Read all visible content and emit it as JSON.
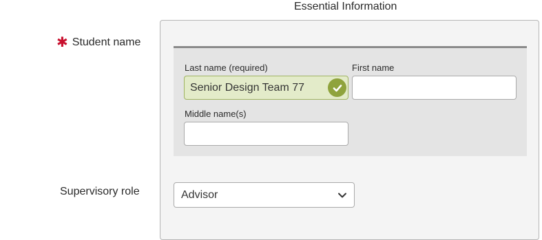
{
  "section": {
    "heading": "Essential Information"
  },
  "student_name": {
    "label": "Student name",
    "required": true,
    "last_name": {
      "label": "Last name (required)",
      "value": "Senior Design Team 77",
      "valid": true
    },
    "first_name": {
      "label": "First name",
      "value": ""
    },
    "middle_name": {
      "label": "Middle name(s)",
      "value": ""
    }
  },
  "supervisory_role": {
    "label": "Supervisory role",
    "selected": "Advisor"
  },
  "colors": {
    "required_star": "#c8102e",
    "valid_field_bg": "#e3ebc9",
    "valid_icon": "#8fa33d"
  },
  "icons": {
    "required": "asterisk-icon",
    "valid": "check-circle-icon",
    "dropdown": "chevron-down-icon"
  }
}
